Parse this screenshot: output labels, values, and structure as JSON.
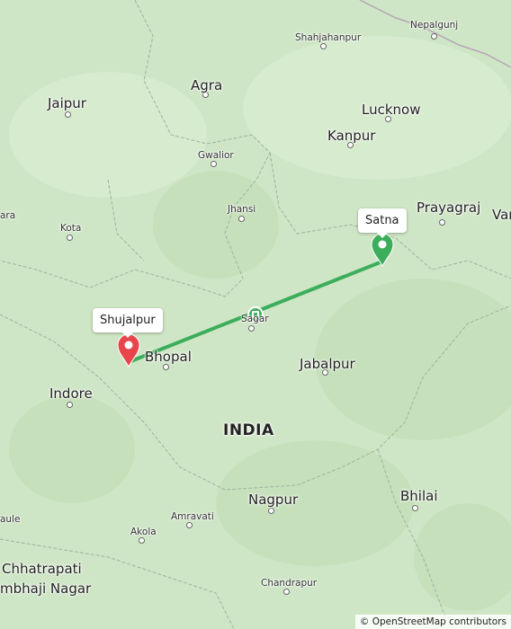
{
  "map": {
    "country_label": "INDIA",
    "cities_major": [
      {
        "name": "Jaipur"
      },
      {
        "name": "Agra"
      },
      {
        "name": "Lucknow"
      },
      {
        "name": "Kanpur"
      },
      {
        "name": "Prayagraj"
      },
      {
        "name": "Var"
      },
      {
        "name": "Bhopal"
      },
      {
        "name": "Indore"
      },
      {
        "name": "Jabalpur"
      },
      {
        "name": "Nagpur"
      },
      {
        "name": "Bhilai"
      },
      {
        "name": "Chhatrapati"
      },
      {
        "name": "mbhaji Nagar"
      }
    ],
    "cities_minor": [
      {
        "name": "Shahjahanpur"
      },
      {
        "name": "Nepalgunj"
      },
      {
        "name": "Gwalior"
      },
      {
        "name": "Jhansi"
      },
      {
        "name": "Kota"
      },
      {
        "name": "ara"
      },
      {
        "name": "Sagar"
      },
      {
        "name": "Amravati"
      },
      {
        "name": "Akola"
      },
      {
        "name": "Chandrapur"
      },
      {
        "name": "aule"
      }
    ]
  },
  "route": {
    "color": "#3cae5b",
    "origin_label": "Satna",
    "destination_label": "Shujalpur",
    "origin_color": "#3cae5b",
    "destination_color": "#e8444c"
  },
  "attribution": "© OpenStreetMap contributors"
}
